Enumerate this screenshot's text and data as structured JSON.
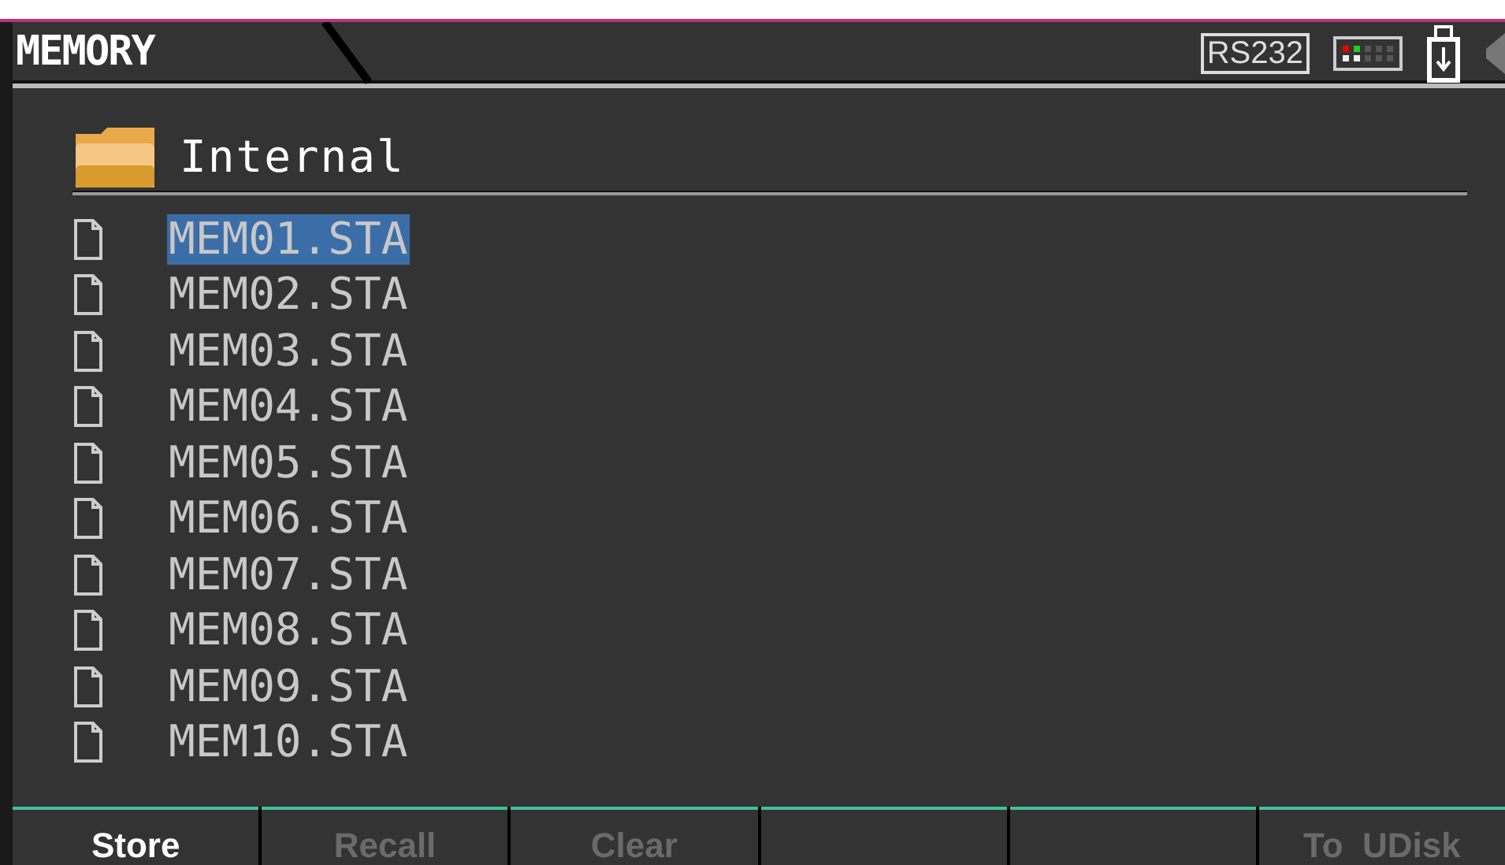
{
  "header": {
    "title": "MEMORY",
    "interface": "RS232"
  },
  "folder": {
    "name": "Internal"
  },
  "files": [
    {
      "name": "MEM01.STA",
      "selected": true
    },
    {
      "name": "MEM02.STA",
      "selected": false
    },
    {
      "name": "MEM03.STA",
      "selected": false
    },
    {
      "name": "MEM04.STA",
      "selected": false
    },
    {
      "name": "MEM05.STA",
      "selected": false
    },
    {
      "name": "MEM06.STA",
      "selected": false
    },
    {
      "name": "MEM07.STA",
      "selected": false
    },
    {
      "name": "MEM08.STA",
      "selected": false
    },
    {
      "name": "MEM09.STA",
      "selected": false
    },
    {
      "name": "MEM10.STA",
      "selected": false
    }
  ],
  "softkeys": [
    {
      "kind": "labeled",
      "label": "Store",
      "disabled": false
    },
    {
      "kind": "labeled",
      "label": "Recall",
      "disabled": true
    },
    {
      "kind": "labeled",
      "label": "Clear",
      "disabled": true
    },
    {
      "kind": "blank"
    },
    {
      "kind": "blank"
    },
    {
      "kind": "labeled",
      "label": "To  UDisk",
      "disabled": true
    }
  ]
}
